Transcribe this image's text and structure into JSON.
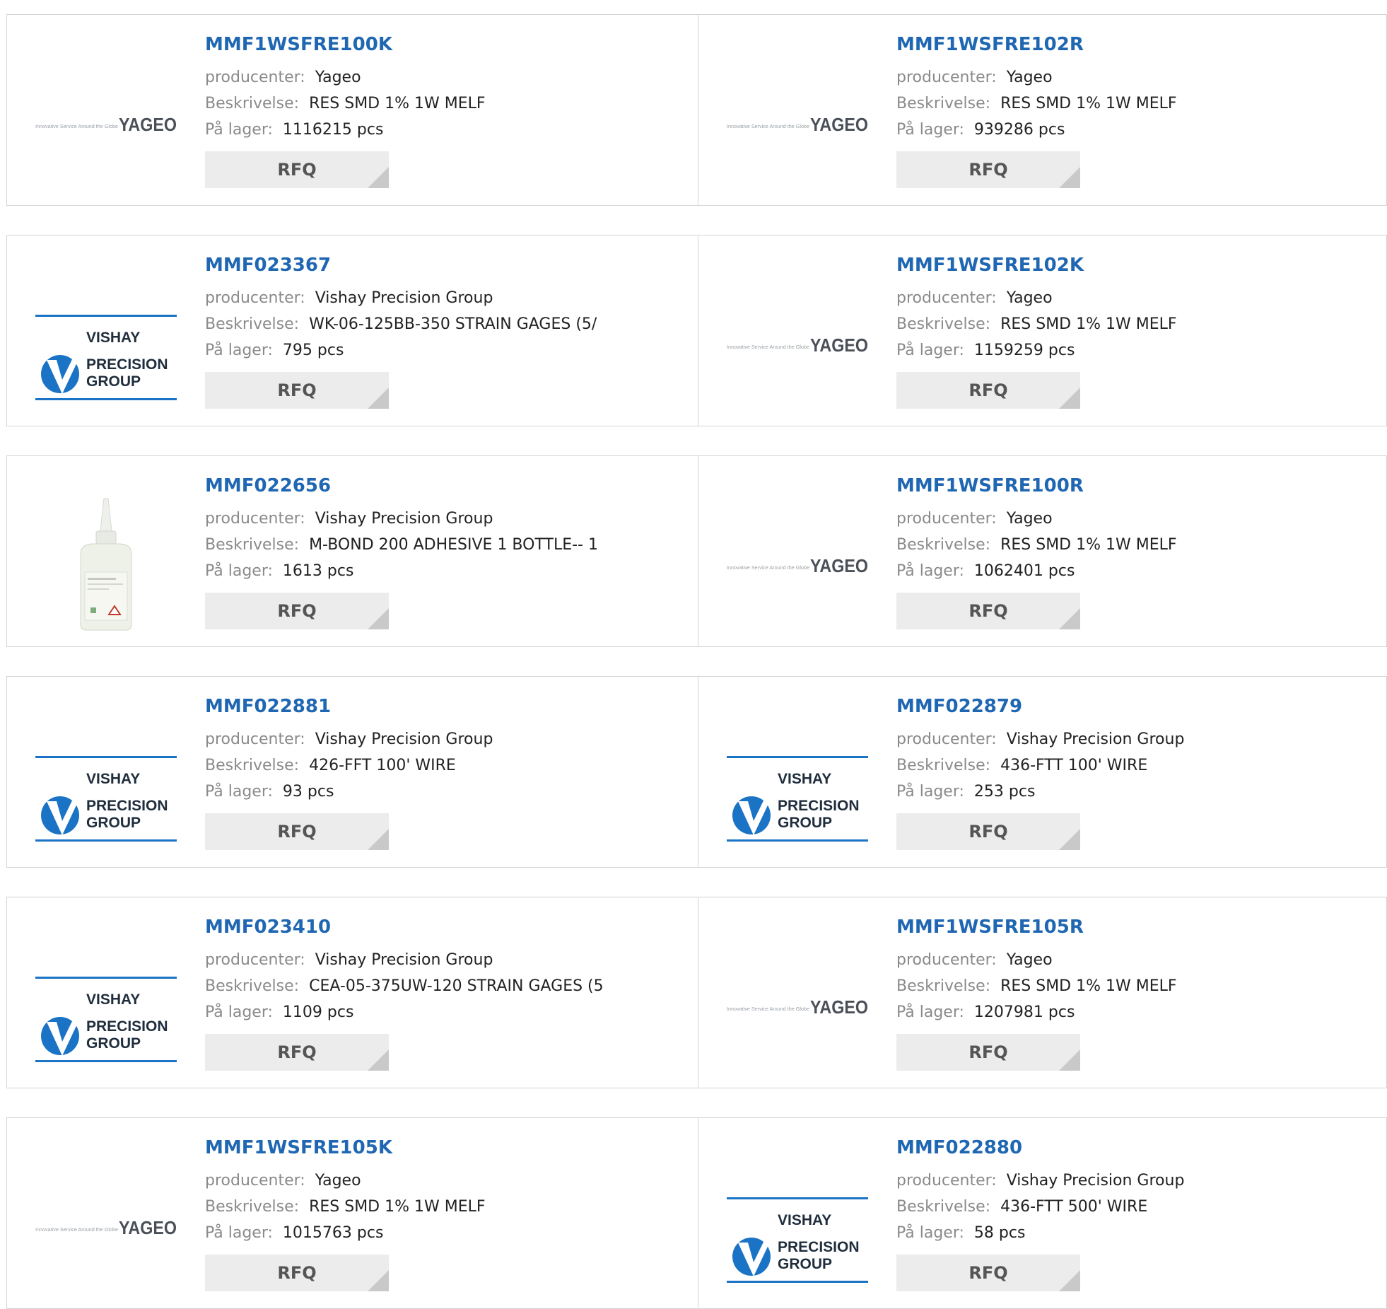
{
  "labels": {
    "manufacturer": "producenter:",
    "description": "Beskrivelse:",
    "stock": "På lager:",
    "rfq": "RFQ"
  },
  "brand_logos": {
    "yageo": {
      "tagline": "Innovative Service Around the Globe",
      "name": "YAGEO"
    },
    "vishay": {
      "line1": "VISHAY",
      "line2": "PRECISION",
      "line3": "GROUP"
    }
  },
  "colors": {
    "part_link": "#1f67b2",
    "vishay_blue": "#1a73c4",
    "yageo_text": "#4a4f58"
  },
  "rows": [
    [
      {
        "part": "MMF1WSFRE100K",
        "manufacturer": "Yageo",
        "description": "RES SMD 1% 1W MELF",
        "stock": "1116215 pcs",
        "logo": "yageo"
      },
      {
        "part": "MMF1WSFRE102R",
        "manufacturer": "Yageo",
        "description": "RES SMD 1% 1W MELF",
        "stock": "939286 pcs",
        "logo": "yageo"
      }
    ],
    [
      {
        "part": "MMF023367",
        "manufacturer": "Vishay Precision Group",
        "description": "WK-06-125BB-350 STRAIN GAGES (5/",
        "stock": "795 pcs",
        "logo": "vishay"
      },
      {
        "part": "MMF1WSFRE102K",
        "manufacturer": "Yageo",
        "description": "RES SMD 1% 1W MELF",
        "stock": "1159259 pcs",
        "logo": "yageo"
      }
    ],
    [
      {
        "part": "MMF022656",
        "manufacturer": "Vishay Precision Group",
        "description": "M-BOND 200 ADHESIVE 1 BOTTLE-- 1",
        "stock": "1613 pcs",
        "logo": "bottle"
      },
      {
        "part": "MMF1WSFRE100R",
        "manufacturer": "Yageo",
        "description": "RES SMD 1% 1W MELF",
        "stock": "1062401 pcs",
        "logo": "yageo"
      }
    ],
    [
      {
        "part": "MMF022881",
        "manufacturer": "Vishay Precision Group",
        "description": "426-FFT 100' WIRE",
        "stock": "93 pcs",
        "logo": "vishay"
      },
      {
        "part": "MMF022879",
        "manufacturer": "Vishay Precision Group",
        "description": "436-FTT 100' WIRE",
        "stock": "253 pcs",
        "logo": "vishay"
      }
    ],
    [
      {
        "part": "MMF023410",
        "manufacturer": "Vishay Precision Group",
        "description": "CEA-05-375UW-120 STRAIN GAGES (5",
        "stock": "1109 pcs",
        "logo": "vishay"
      },
      {
        "part": "MMF1WSFRE105R",
        "manufacturer": "Yageo",
        "description": "RES SMD 1% 1W MELF",
        "stock": "1207981 pcs",
        "logo": "yageo"
      }
    ],
    [
      {
        "part": "MMF1WSFRE105K",
        "manufacturer": "Yageo",
        "description": "RES SMD 1% 1W MELF",
        "stock": "1015763 pcs",
        "logo": "yageo"
      },
      {
        "part": "MMF022880",
        "manufacturer": "Vishay Precision Group",
        "description": "436-FTT 500' WIRE",
        "stock": "58 pcs",
        "logo": "vishay"
      }
    ]
  ]
}
